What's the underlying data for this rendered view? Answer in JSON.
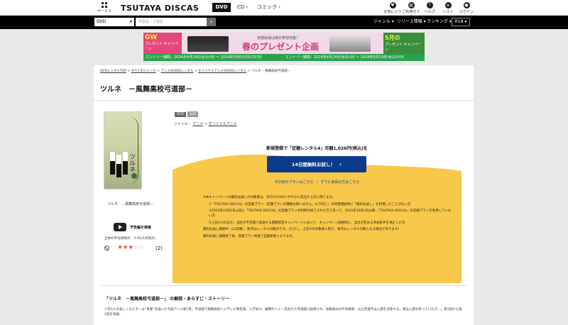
{
  "header": {
    "services_label": "サービス",
    "logo": "TSUTAYA DISCAS",
    "categories": [
      "DVD",
      "CD",
      "コミック"
    ],
    "icons": [
      {
        "name": "favorites-icon",
        "label": "お気に入り"
      },
      {
        "name": "guide-icon",
        "label": "ご利用ガイド"
      },
      {
        "name": "help-icon",
        "label": "ヘルプ"
      },
      {
        "name": "list-icon",
        "label": "リスト"
      },
      {
        "name": "login-icon",
        "label": "ログイン"
      }
    ]
  },
  "searchbar": {
    "scope": "DVD",
    "placeholder": "作品名・人物名",
    "nav": [
      "ジャンル",
      "リリース情報",
      "ランキング"
    ],
    "r18": "R18"
  },
  "banner": {
    "left_title": "GW",
    "left_text": "プレゼント キャンペーン",
    "mid_text": "定額会員は両方参加可能！",
    "big_text": "春のプレゼント企画",
    "right_title": "5月の",
    "right_text": "プレゼント キャンペーン",
    "period1": "エントリー期間：2024年4月24日(水)0:00 ～ 2024年5月6日(月)23:59",
    "period2": "エントリー期間：2024年4月24日(水)0:00 ～ 2024年5月23日(木)23:59"
  },
  "breadcrumb": {
    "links": [
      "DVDレンタルTOP",
      "すべてのジャンル",
      "アニメのDVDレンタル",
      "オリジナルアニメのDVDレンタル"
    ],
    "current": "ツルネ －風舞高校弓道部－"
  },
  "title": "ツルネ　－風舞高校弓道部－",
  "poster": {
    "title_text": "ツルネ"
  },
  "sidebar": {
    "product_title": "ツルネ　－風舞高校弓道部－",
    "trailer_label": "予告編を検索",
    "rating_label": "全体の平均評価点： 2.65(5点満点)",
    "stars": 3,
    "stars_max": 5,
    "review_count": "(2)"
  },
  "badges": [
    "DVD",
    "旧作"
  ],
  "genre": {
    "label": "ジャンル：",
    "parent": "アニメ",
    "child": "オリジナルアニメ"
  },
  "campaign": {
    "offer": "新規登録で「定額レンタル4」月額1,026円(税込)を",
    "cta_label": "14日間無料お試し！",
    "other_plans": "その他のプランはこちら",
    "member_link": "すでに会員の方はこちら",
    "notes": [
      "※本キャンペーンの無料お試しの対象者は、次の①②③のいずれかに該当する方に限ります。",
      "①「TSUTAYA DISCAS」の定額プラン（定額プランの種類は問いません。以下同じ）の利用開始時に「無料お試し」を利用したことがない方",
      "②2022年10月2日以前に「TSUTAYA DISCAS」の定額プランの利用を終了された方であって、2022年10月3日以降、「TSUTAYA DISCAS」の定額プランを利用していない方",
      "③上記①②のほか、当社が不定期で実施する期間限定キャンペーンにおいて、キャンペーン開始時に、当社が定める参加条件を満たした方",
      "無料お試し期間中（14日間）、新作はレンタル対象外です。（ただし、上記③の対象者に限り、新作もレンタル対象となる場合があります）",
      "無料お試し期間終了後、登録プラン料金で自動更新となります。"
    ]
  },
  "description": {
    "title": "「ツルネ　－風舞高校弓道部－」 の解説・あらすじ・ストーリー",
    "text": "少年5人の美しくもビターな“青春”を描いた弓道アニメ第1巻。弓道部で風舞高校へ入学した鳴宮湊。入学早々、顧問のトミー先生から弓道部に勧誘され、幼馴染みの竹早静弥、山之内遼平は入部を決意する。湊は入部を断っていたが…。第1話から第2話を収録。"
  },
  "colors": {
    "accent_blue": "#0d3b8c",
    "campaign_yellow": "#f7c84a",
    "star_red": "#e8554e"
  }
}
